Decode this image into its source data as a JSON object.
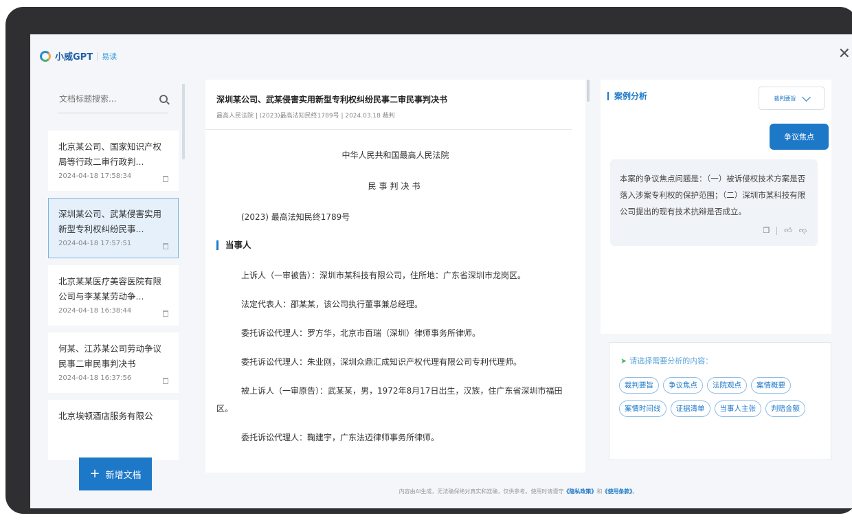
{
  "brand": {
    "name": "小威GPT",
    "product": "易读"
  },
  "sidebar": {
    "search_placeholder": "文档标题搜索...",
    "documents": [
      {
        "title": "北京某公司、国家知识产权局等行政二审行政判...",
        "time": "2024-04-18 17:58:34",
        "active": false
      },
      {
        "title": "深圳某公司、武某侵害实用新型专利权纠纷民事...",
        "time": "2024-04-18 17:57:51",
        "active": true
      },
      {
        "title": "北京某某医疗美容医院有限公司与李某某劳动争...",
        "time": "2024-04-18 16:38:44",
        "active": false
      },
      {
        "title": "何某、江苏某公司劳动争议民事二审民事判决书",
        "time": "2024-04-18 16:37:56",
        "active": false
      },
      {
        "title": "北京埃顿酒店服务有限公",
        "time": "",
        "active": false
      }
    ],
    "add_button": "新增文档"
  },
  "document": {
    "title": "深圳某公司、武某侵害实用新型专利权纠纷民事二审民事判决书",
    "meta": "最高人民法院 | (2023)最高法知民终1789号 | 2024.03.18 裁判",
    "court": "中华人民共和国最高人民法院",
    "doc_type": "民事判决书",
    "case_no": "(2023) 最高法知民终1789号",
    "section": "当事人",
    "paragraphs": [
      "上诉人（一审被告）：深圳市某科技有限公司，住所地：广东省深圳市龙岗区。",
      "法定代表人：邵某某，该公司执行董事兼总经理。",
      "委托诉讼代理人：罗方华，北京市百瑞（深圳）律师事务所律师。",
      "委托诉讼代理人：朱业刚，深圳众鼎汇成知识产权代理有限公司专利代理师。",
      "被上诉人（一审原告）：武某某，男，1972年8月17日出生，汉族，住广东省深圳市福田区。",
      "委托诉讼代理人：鞠建宇，广东法迈律师事务所律师。"
    ]
  },
  "analysis": {
    "title": "案例分析",
    "select_value": "裁判要旨",
    "question_button": "争议焦点",
    "answer": "本案的争议焦点问题是：（一）被诉侵权技术方案是否落入涉案专利权的保护范围；（二）深圳市某科技有限公司提出的现有技术抗辩是否成立。",
    "suggest_title": "请选择需要分析的内容：",
    "tags": [
      "裁判要旨",
      "争议焦点",
      "法院观点",
      "案情概要",
      "案情时间线",
      "证据清单",
      "当事人主张",
      "判赔金额"
    ]
  },
  "footer": {
    "text_before": "内容由AI生成，无法确保绝对真实和准确，仅供参考。使用时请遵守",
    "privacy": "《隐私政策》",
    "and": "和",
    "terms": "《使用条款》",
    "end": "。"
  }
}
